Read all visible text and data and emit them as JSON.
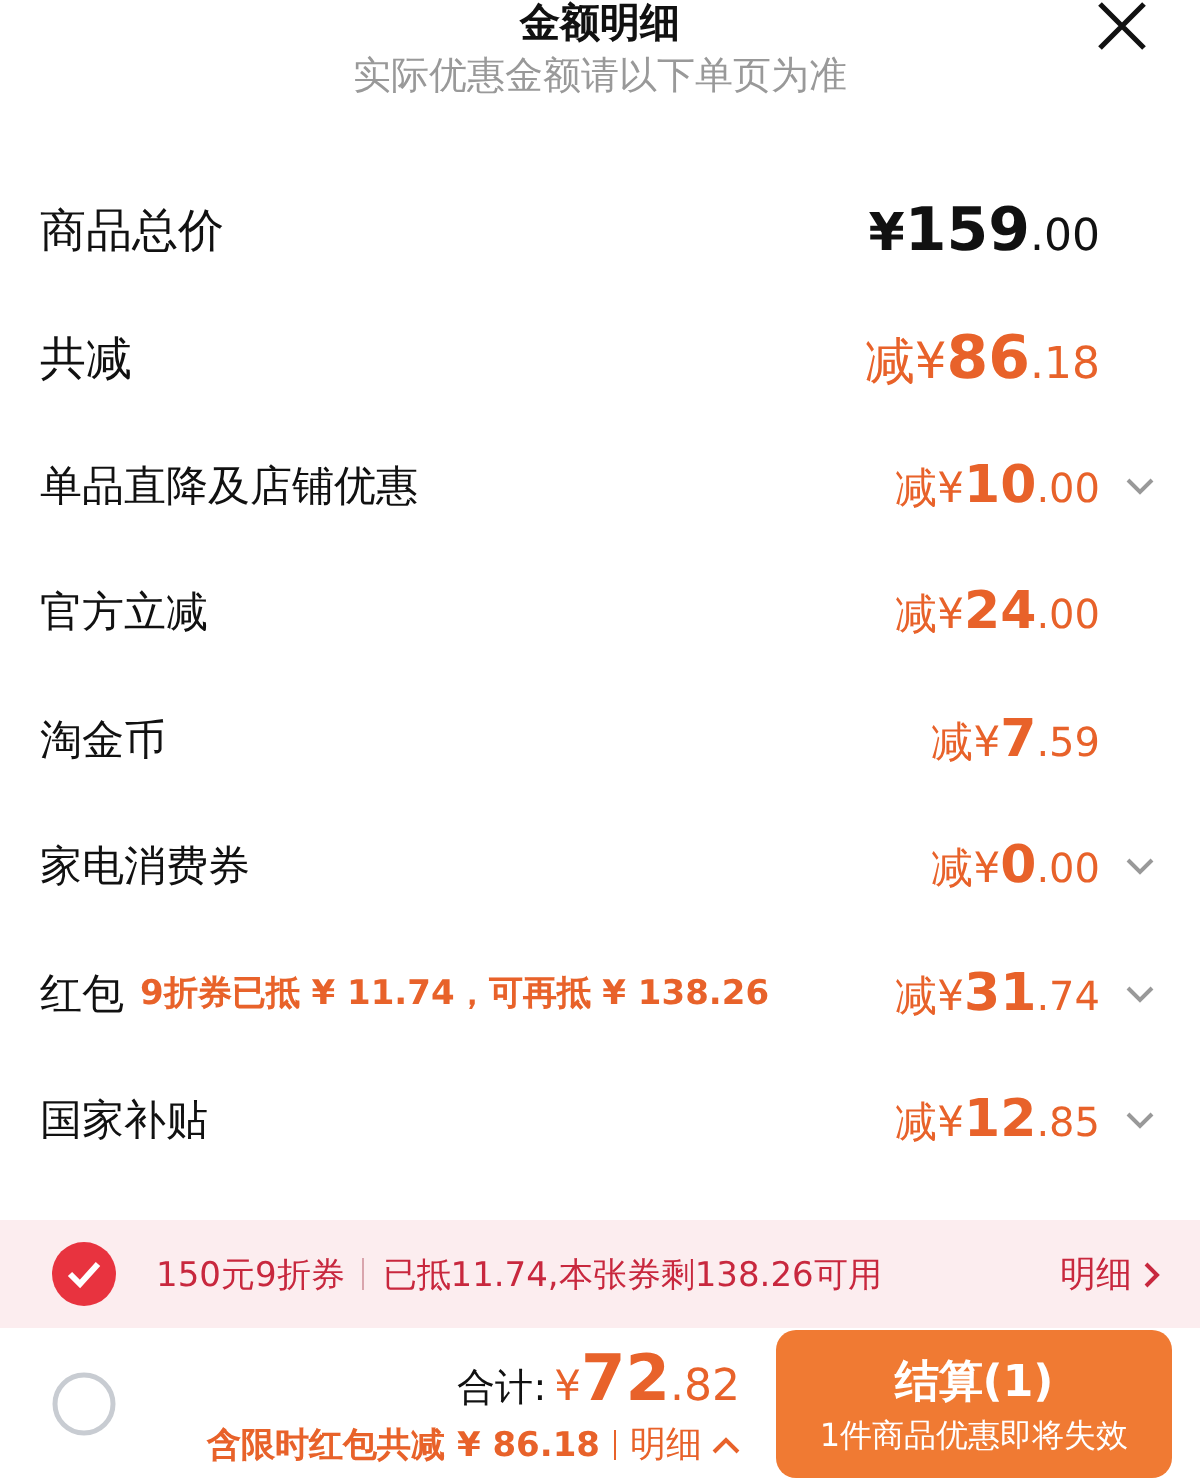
{
  "header": {
    "title": "金额明细",
    "subtitle": "实际优惠金额请以下单页为准"
  },
  "rows": [
    {
      "kind": "total",
      "label": "商品总价",
      "amount": {
        "prefix": "¥",
        "integer": "159",
        "decimal": ".00"
      },
      "expandable": false
    },
    {
      "kind": "reduction",
      "label": "共减",
      "amount": {
        "prefix": "减¥",
        "integer": "86",
        "decimal": ".18"
      },
      "expandable": false
    },
    {
      "kind": "item",
      "label": "单品直降及店铺优惠",
      "amount": {
        "prefix": "减¥",
        "integer": "10",
        "decimal": ".00"
      },
      "expandable": true
    },
    {
      "kind": "item",
      "label": "官方立减",
      "amount": {
        "prefix": "减¥",
        "integer": "24",
        "decimal": ".00"
      },
      "expandable": false
    },
    {
      "kind": "item",
      "label": "淘金币",
      "amount": {
        "prefix": "减¥",
        "integer": "7",
        "decimal": ".59"
      },
      "expandable": false
    },
    {
      "kind": "item",
      "label": "家电消费券",
      "amount": {
        "prefix": "减¥",
        "integer": "0",
        "decimal": ".00"
      },
      "expandable": true
    },
    {
      "kind": "item",
      "label": "红包",
      "note": "9折券已抵 ¥ 11.74，可再抵 ¥ 138.26",
      "amount": {
        "prefix": "减¥",
        "integer": "31",
        "decimal": ".74"
      },
      "expandable": true
    },
    {
      "kind": "item",
      "label": "国家补贴",
      "amount": {
        "prefix": "减¥",
        "integer": "12",
        "decimal": ".85"
      },
      "expandable": true
    }
  ],
  "coupon": {
    "checked": true,
    "name": "150元9折券",
    "detail": "已抵11.74,本张券剩138.26可用",
    "link": "明细"
  },
  "checkout": {
    "select_all": false,
    "total_label": "合计:",
    "total": {
      "prefix": "¥",
      "integer": "72",
      "decimal": ".82"
    },
    "saving": "含限时红包共减 ¥ 86.18",
    "saving_link": "明细",
    "button": "结算(1)",
    "button_note": "1件商品优惠即将失效"
  }
}
